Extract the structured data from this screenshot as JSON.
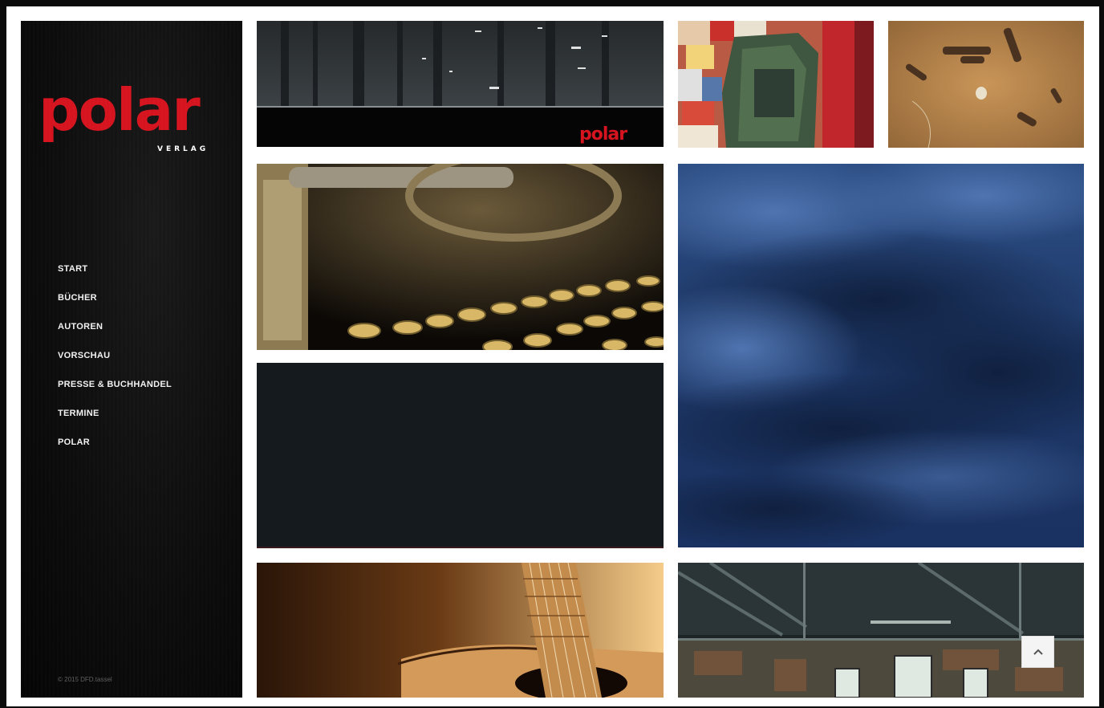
{
  "brand": {
    "logo_word": "polar",
    "logo_sub": "VERLAG",
    "logo_color": "#d6141f"
  },
  "nav": {
    "items": [
      {
        "label": "START"
      },
      {
        "label": "BÜCHER"
      },
      {
        "label": "AUTOREN"
      },
      {
        "label": "VORSCHAU"
      },
      {
        "label": "PRESSE & BUCHHANDEL"
      },
      {
        "label": "TERMINE"
      },
      {
        "label": "POLAR"
      }
    ]
  },
  "footer": {
    "copyright": "© 2015 DFD.tassel"
  },
  "tiles": [
    {
      "name": "tile-forest-night",
      "subject": "dark forest at night with polar logo banner"
    },
    {
      "name": "tile-mosaic-wall",
      "subject": "colorful broken mosaic wall"
    },
    {
      "name": "tile-sand-bullets",
      "subject": "bullet casings in sand"
    },
    {
      "name": "tile-typewriter",
      "subject": "vintage typewriter keys"
    },
    {
      "name": "tile-dark-panel",
      "subject": "dark slate panel"
    },
    {
      "name": "tile-storm-clouds",
      "subject": "dark blue storm clouds"
    },
    {
      "name": "tile-guitar",
      "subject": "acoustic guitar neck"
    },
    {
      "name": "tile-abandoned-hall",
      "subject": "abandoned industrial hall"
    }
  ],
  "scroll_top": {
    "icon": "chevron-up-icon"
  }
}
